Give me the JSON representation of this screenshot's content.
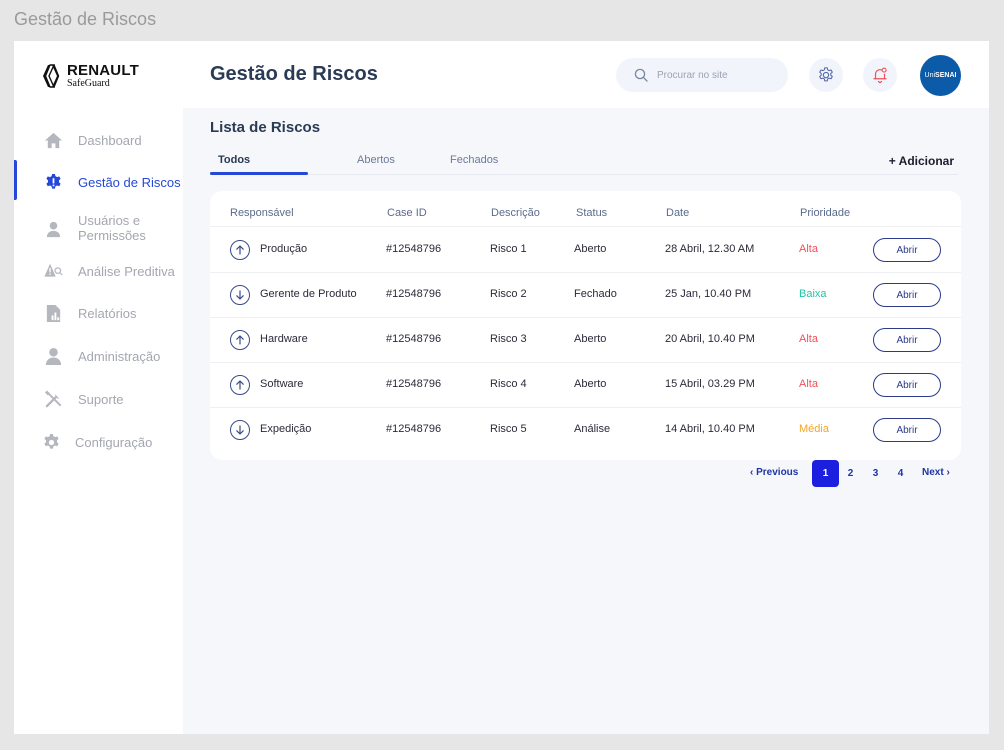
{
  "window": {
    "title": "Gestão de Riscos"
  },
  "brand": {
    "name": "RENAULT",
    "sub": "SafeGuard"
  },
  "header": {
    "title": "Gestão de Riscos",
    "search_placeholder": "Procurar no site",
    "avatar_prefix": "Uni",
    "avatar_bold": "SENAI"
  },
  "sidebar": {
    "items": [
      {
        "label": "Dashboard",
        "icon": "home-icon"
      },
      {
        "label": "Gestão de Riscos",
        "icon": "risk-gear-icon",
        "active": true
      },
      {
        "label": "Usuários e Permissões",
        "icon": "user-icon"
      },
      {
        "label": "Análise Preditiva",
        "icon": "warning-search-icon"
      },
      {
        "label": "Relatórios",
        "icon": "report-icon"
      },
      {
        "label": "Administração",
        "icon": "admin-user-icon"
      },
      {
        "label": "Suporte",
        "icon": "tools-icon"
      },
      {
        "label": "Configuração",
        "icon": "gear-icon"
      }
    ]
  },
  "main": {
    "section_title": "Lista de Riscos",
    "tabs": [
      {
        "label": "Todos",
        "active": true
      },
      {
        "label": "Abertos"
      },
      {
        "label": "Fechados"
      }
    ],
    "add_label": "+ Adicionar"
  },
  "table": {
    "columns": [
      "Responsável",
      "Case ID",
      "Descrição",
      "Status",
      "Date",
      "Prioridade"
    ],
    "rows": [
      {
        "direction": "up",
        "responsavel": "Produção",
        "case_id": "#12548796",
        "descricao": "Risco 1",
        "status": "Aberto",
        "date": "28 Abril, 12.30 AM",
        "prioridade": "Alta",
        "action": "Abrir"
      },
      {
        "direction": "down",
        "responsavel": "Gerente de Produto",
        "case_id": "#12548796",
        "descricao": "Risco 2",
        "status": "Fechado",
        "date": "25 Jan, 10.40 PM",
        "prioridade": "Baixa",
        "action": "Abrir"
      },
      {
        "direction": "up",
        "responsavel": "Hardware",
        "case_id": "#12548796",
        "descricao": "Risco 3",
        "status": "Aberto",
        "date": "20 Abril, 10.40 PM",
        "prioridade": "Alta",
        "action": "Abrir"
      },
      {
        "direction": "up",
        "responsavel": "Software",
        "case_id": "#12548796",
        "descricao": "Risco 4",
        "status": "Aberto",
        "date": "15 Abril, 03.29 PM",
        "prioridade": "Alta",
        "action": "Abrir"
      },
      {
        "direction": "down",
        "responsavel": "Expedição",
        "case_id": "#12548796",
        "descricao": "Risco 5",
        "status": "Análise",
        "date": "14 Abril, 10.40 PM",
        "prioridade": "Média",
        "action": "Abrir"
      }
    ]
  },
  "priority_colors": {
    "Alta": "#f0505a",
    "Baixa": "#1fc7a4",
    "Média": "#f5a623"
  },
  "pagination": {
    "previous": "Previous",
    "next": "Next",
    "pages": [
      "1",
      "2",
      "3",
      "4"
    ],
    "current": "1"
  }
}
